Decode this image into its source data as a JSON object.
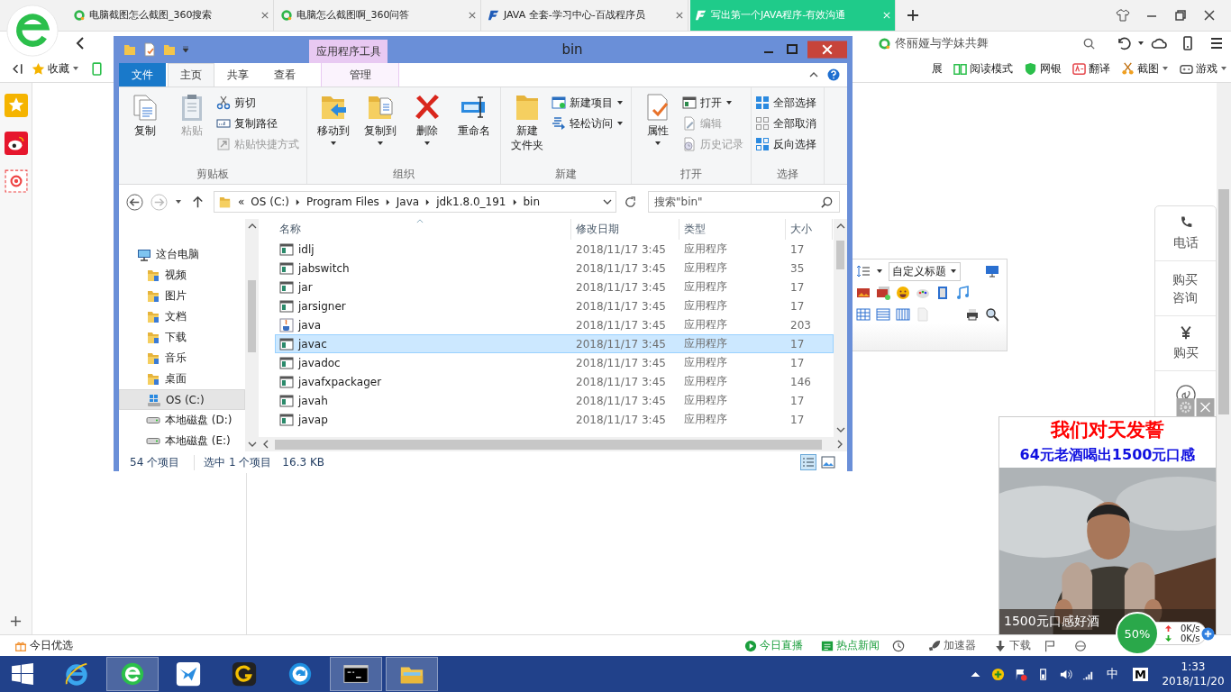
{
  "browser": {
    "tabs": [
      {
        "title": "电脑截图怎么截图_360搜索",
        "kind": "search",
        "selected": false
      },
      {
        "title": "电脑怎么截图啊_360问答",
        "kind": "search",
        "selected": false
      },
      {
        "title": "JAVA 全套-学习中心-百战程序员",
        "kind": "site",
        "selected": false
      },
      {
        "title": "写出第一个JAVA程序-有效沟通",
        "kind": "site",
        "selected": true
      }
    ],
    "search_text": "佟丽娅与学妹共舞",
    "favorites": "收藏",
    "bookmark_cut": "展",
    "bookmarks": [
      "阅读模式",
      "网银",
      "翻译",
      "截图",
      "游戏"
    ]
  },
  "explorer": {
    "title": "bin",
    "context_label": "应用程序工具",
    "tabs": [
      {
        "label": "文件",
        "kind": "file",
        "selected": false
      },
      {
        "label": "主页",
        "kind": "tab",
        "selected": true
      },
      {
        "label": "共享",
        "kind": "tab",
        "selected": false
      },
      {
        "label": "查看",
        "kind": "tab",
        "selected": false
      },
      {
        "label": "管理",
        "kind": "context",
        "selected": false
      }
    ],
    "groups": [
      {
        "name": "剪贴板",
        "large": [
          {
            "label": "复制",
            "disabled": false,
            "dropdown": false
          },
          {
            "label": "粘贴",
            "disabled": true,
            "dropdown": false
          }
        ],
        "small": [
          {
            "label": "剪切",
            "disabled": false,
            "dropdown": false
          },
          {
            "label": "复制路径",
            "disabled": false,
            "dropdown": false
          },
          {
            "label": "粘贴快捷方式",
            "disabled": true,
            "dropdown": false
          }
        ]
      },
      {
        "name": "组织",
        "large": [
          {
            "label": "移动到",
            "disabled": false,
            "dropdown": true
          },
          {
            "label": "复制到",
            "disabled": false,
            "dropdown": true
          },
          {
            "label": "删除",
            "disabled": false,
            "dropdown": true
          },
          {
            "label": "重命名",
            "disabled": false,
            "dropdown": false
          }
        ]
      },
      {
        "name": "新建",
        "large": [
          {
            "label": [
              "新建",
              "文件夹"
            ],
            "disabled": false,
            "dropdown": false
          }
        ],
        "small": [
          {
            "label": "新建项目",
            "disabled": false,
            "dropdown": true
          },
          {
            "label": "轻松访问",
            "disabled": false,
            "dropdown": true
          }
        ]
      },
      {
        "name": "打开",
        "large": [
          {
            "label": "属性",
            "disabled": false,
            "dropdown": true
          }
        ],
        "small": [
          {
            "label": "打开",
            "disabled": false,
            "dropdown": true
          },
          {
            "label": "编辑",
            "disabled": true,
            "dropdown": false
          },
          {
            "label": "历史记录",
            "disabled": true,
            "dropdown": false
          }
        ]
      },
      {
        "name": "选择",
        "small": [
          {
            "label": "全部选择",
            "disabled": false,
            "dropdown": false
          },
          {
            "label": "全部取消",
            "disabled": false,
            "dropdown": false
          },
          {
            "label": "反向选择",
            "disabled": false,
            "dropdown": false
          }
        ]
      }
    ],
    "path_overflow": "«",
    "path": [
      "OS (C:)",
      "Program Files",
      "Java",
      "jdk1.8.0_191",
      "bin"
    ],
    "search_placeholder": "搜索\"bin\"",
    "tree": [
      {
        "label": "这台电脑",
        "kind": "pc",
        "selected": false,
        "children": [
          {
            "label": "视频",
            "kind": "folder",
            "selected": false
          },
          {
            "label": "图片",
            "kind": "folder",
            "selected": false
          },
          {
            "label": "文档",
            "kind": "folder",
            "selected": false
          },
          {
            "label": "下载",
            "kind": "folder",
            "selected": false
          },
          {
            "label": "音乐",
            "kind": "folder",
            "selected": false
          },
          {
            "label": "桌面",
            "kind": "folder",
            "selected": false
          },
          {
            "label": "OS (C:)",
            "kind": "os",
            "selected": true
          },
          {
            "label": "本地磁盘 (D:)",
            "kind": "disk",
            "selected": false
          },
          {
            "label": "本地磁盘 (E:)",
            "kind": "disk",
            "selected": false
          }
        ]
      }
    ],
    "columns": [
      "名称",
      "修改日期",
      "类型",
      "大小"
    ],
    "files": [
      {
        "name": "idlj",
        "date": "2018/11/17 3:45",
        "type": "应用程序",
        "size": "17",
        "kind": "exe",
        "selected": false
      },
      {
        "name": "jabswitch",
        "date": "2018/11/17 3:45",
        "type": "应用程序",
        "size": "35",
        "kind": "exe",
        "selected": false
      },
      {
        "name": "jar",
        "date": "2018/11/17 3:45",
        "type": "应用程序",
        "size": "17",
        "kind": "exe",
        "selected": false
      },
      {
        "name": "jarsigner",
        "date": "2018/11/17 3:45",
        "type": "应用程序",
        "size": "17",
        "kind": "exe",
        "selected": false
      },
      {
        "name": "java",
        "date": "2018/11/17 3:45",
        "type": "应用程序",
        "size": "203",
        "kind": "java",
        "selected": false
      },
      {
        "name": "javac",
        "date": "2018/11/17 3:45",
        "type": "应用程序",
        "size": "17",
        "kind": "exe",
        "selected": true
      },
      {
        "name": "javadoc",
        "date": "2018/11/17 3:45",
        "type": "应用程序",
        "size": "17",
        "kind": "exe",
        "selected": false
      },
      {
        "name": "javafxpackager",
        "date": "2018/11/17 3:45",
        "type": "应用程序",
        "size": "146",
        "kind": "exe",
        "selected": false
      },
      {
        "name": "javah",
        "date": "2018/11/17 3:45",
        "type": "应用程序",
        "size": "17",
        "kind": "exe",
        "selected": false
      },
      {
        "name": "javap",
        "date": "2018/11/17 3:45",
        "type": "应用程序",
        "size": "17",
        "kind": "exe",
        "selected": false
      }
    ],
    "status": {
      "count": "54 个项目",
      "selection": "选中 1 个项目",
      "size": "16.3 KB"
    }
  },
  "editor_toolbar": {
    "heading": "自定义标题"
  },
  "side_panel": [
    {
      "label": "电话",
      "kind": "phone"
    },
    {
      "label": "购买咨询",
      "kind": "text"
    },
    {
      "label": "购买",
      "kind": "yen"
    },
    {
      "kind": "mini"
    }
  ],
  "ad": {
    "headline": "我们对天发誓",
    "subline": "64元老酒喝出1500元口感",
    "caption": "1500元口感好酒"
  },
  "status_bar": {
    "left": "今日优选",
    "items": [
      {
        "label": "今日直播",
        "color": "#1a9e3c"
      },
      {
        "label": "热点新闻",
        "color": "#1a9e3c"
      },
      {
        "label": "加速器",
        "color": "#555555"
      },
      {
        "label": "下载",
        "color": "#555555"
      }
    ]
  },
  "speed": {
    "percent": "50%",
    "up": "0K/s",
    "down": "0K/s"
  },
  "taskbar": {
    "apps": [
      {
        "kind": "ie",
        "active": false
      },
      {
        "kind": "browser",
        "active": true
      },
      {
        "kind": "bird",
        "active": false
      },
      {
        "kind": "g",
        "active": false
      },
      {
        "kind": "circle",
        "active": false
      },
      {
        "kind": "cmd",
        "active": true
      },
      {
        "kind": "explorer",
        "active": true
      }
    ],
    "ime": "中",
    "m": "M",
    "time": "1:33",
    "date": "2018/11/20"
  }
}
